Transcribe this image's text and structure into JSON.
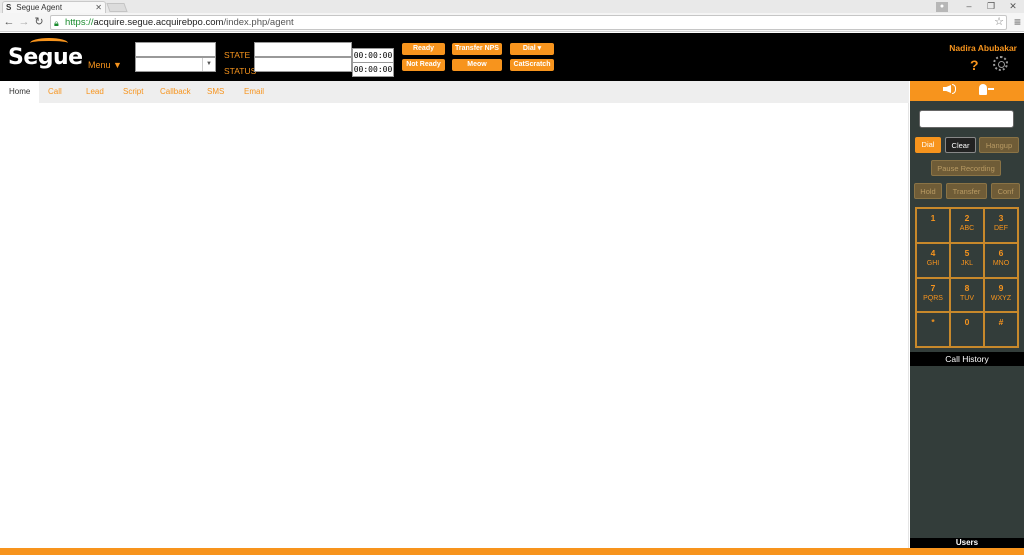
{
  "browser": {
    "tab_title": "Segue Agent",
    "tab_close": "✕",
    "favicon": "S",
    "url_scheme": "https://",
    "url_host": "acquire.segue.acquirebpo.com",
    "url_path": "/index.php/agent",
    "icons": [
      "back-icon",
      "forward-icon",
      "refresh-icon",
      "lock-icon",
      "star-icon",
      "menu-icon"
    ]
  },
  "header": {
    "logo_text": "Segue",
    "menu_label": "Menu ▼",
    "state_label": "STATE",
    "status_label": "STATUS",
    "timer_1": "00:00:00",
    "timer_2": "00:00:00",
    "buttons": {
      "ready": "Ready",
      "not_ready": "Not Ready",
      "transfer_nps": "Transfer NPS",
      "meow": "Meow",
      "dial": "Dial ▾",
      "catscratch": "CatScratch"
    },
    "agent_name": "Nadira Abubakar",
    "help": "?"
  },
  "nav": {
    "tabs": [
      "Home",
      "Call",
      "Lead",
      "Script",
      "Callback",
      "SMS",
      "Email"
    ],
    "active": "Home"
  },
  "panel": {
    "dial": "Dial",
    "clear": "Clear",
    "hangup": "Hangup",
    "pause_recording": "Pause Recording",
    "hold": "Hold",
    "transfer": "Transfer",
    "conf": "Conf",
    "keys": [
      {
        "n": "1",
        "s": ""
      },
      {
        "n": "2",
        "s": "ABC"
      },
      {
        "n": "3",
        "s": "DEF"
      },
      {
        "n": "4",
        "s": "GHI"
      },
      {
        "n": "5",
        "s": "JKL"
      },
      {
        "n": "6",
        "s": "MNO"
      },
      {
        "n": "7",
        "s": "PQRS"
      },
      {
        "n": "8",
        "s": "TUV"
      },
      {
        "n": "9",
        "s": "WXYZ"
      },
      {
        "n": "*",
        "s": ""
      },
      {
        "n": "0",
        "s": ""
      },
      {
        "n": "#",
        "s": ""
      }
    ],
    "call_history": "Call History",
    "users": "Users"
  },
  "colors": {
    "accent": "#f7941d",
    "header_bg": "#000000",
    "panel_bg": "#333d3a"
  }
}
